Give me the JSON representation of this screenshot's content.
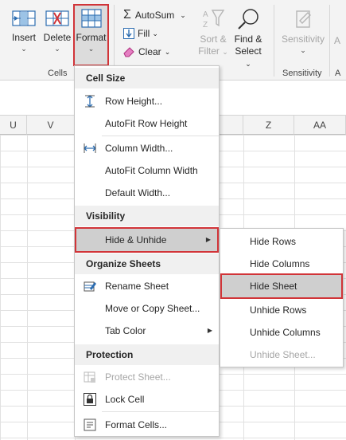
{
  "ribbon": {
    "insert_label": "Insert",
    "delete_label": "Delete",
    "format_label": "Format",
    "cells_group": "Cells",
    "autosum_label": "AutoSum",
    "fill_label": "Fill",
    "clear_label": "Clear",
    "sort_line1": "Sort &",
    "sort_line2": "Filter",
    "find_line1": "Find &",
    "find_line2": "Select",
    "sensitivity_label": "Sensitivity",
    "sensitivity_group": "Sensitivity",
    "edge_label": "A",
    "edge_group": "A"
  },
  "columns": [
    "U",
    "V",
    "Z",
    "AA"
  ],
  "menu": {
    "cell_size": "Cell Size",
    "row_height": "Row Height...",
    "autofit_row": "AutoFit Row Height",
    "column_width": "Column Width...",
    "autofit_column": "AutoFit Column Width",
    "default_width": "Default Width...",
    "visibility": "Visibility",
    "hide_unhide": "Hide & Unhide",
    "organize": "Organize Sheets",
    "rename": "Rename Sheet",
    "move_copy": "Move or Copy Sheet...",
    "tab_color": "Tab Color",
    "protection": "Protection",
    "protect_sheet": "Protect Sheet...",
    "lock_cell": "Lock Cell",
    "format_cells": "Format Cells..."
  },
  "submenu": {
    "hide_rows": "Hide Rows",
    "hide_columns": "Hide Columns",
    "hide_sheet": "Hide Sheet",
    "unhide_rows": "Unhide Rows",
    "unhide_columns": "Unhide Columns",
    "unhide_sheet": "Unhide Sheet..."
  },
  "colors": {
    "highlight_border": "#d13438",
    "accent_blue": "#2b6cb0"
  }
}
